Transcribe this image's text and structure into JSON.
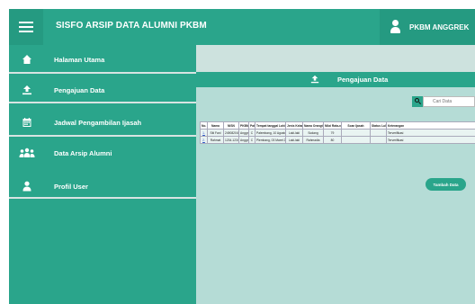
{
  "header": {
    "title": "SISFO ARSIP DATA ALUMNI PKBM",
    "user": "PKBM ANGGREK"
  },
  "sidebar": {
    "items": [
      {
        "label": "Halaman Utama",
        "icon": "home-icon"
      },
      {
        "label": "Pengajuan Data",
        "icon": "upload-icon"
      },
      {
        "label": "Jadwal Pengambilan Ijasah",
        "icon": "calendar-icon"
      },
      {
        "label": "Data Arsip Alumni",
        "icon": "users-icon"
      },
      {
        "label": "Profil User",
        "icon": "user-icon"
      }
    ]
  },
  "main": {
    "panel_title": "Pengajuan Data",
    "search_placeholder": "Cari Data",
    "add_button": "Tambah Data",
    "table": {
      "columns": [
        "No.",
        "Nama",
        "NISN",
        "PKBM",
        "Paket",
        "Tempat tanggal Lahir",
        "Jenis Kelamin",
        "Nama Orangtua",
        "Nilai Rata-rata",
        "Scan Ijasah",
        "Status Lulus",
        "Keterangan"
      ],
      "rows": [
        [
          "1.",
          "Siti Fani",
          "2490820456",
          "Anggrek",
          "C",
          "Palembang, 10 Agustus 2004",
          "Laki-laki",
          "Sodang",
          "79",
          "",
          "",
          "Terverifikasi"
        ],
        [
          "2.",
          "Rahmat",
          "1234-1234",
          "Anggrek",
          "C",
          "Plembang, 03 Maret 2019",
          "Laki-laki",
          "Rahmadia",
          "80",
          "",
          "",
          "Terverifikasi"
        ]
      ]
    }
  },
  "colors": {
    "primary": "#2aa58b",
    "primary_dark": "#259a81",
    "content_bg": "#b5dcd6",
    "divider": "#d7e4e2"
  }
}
